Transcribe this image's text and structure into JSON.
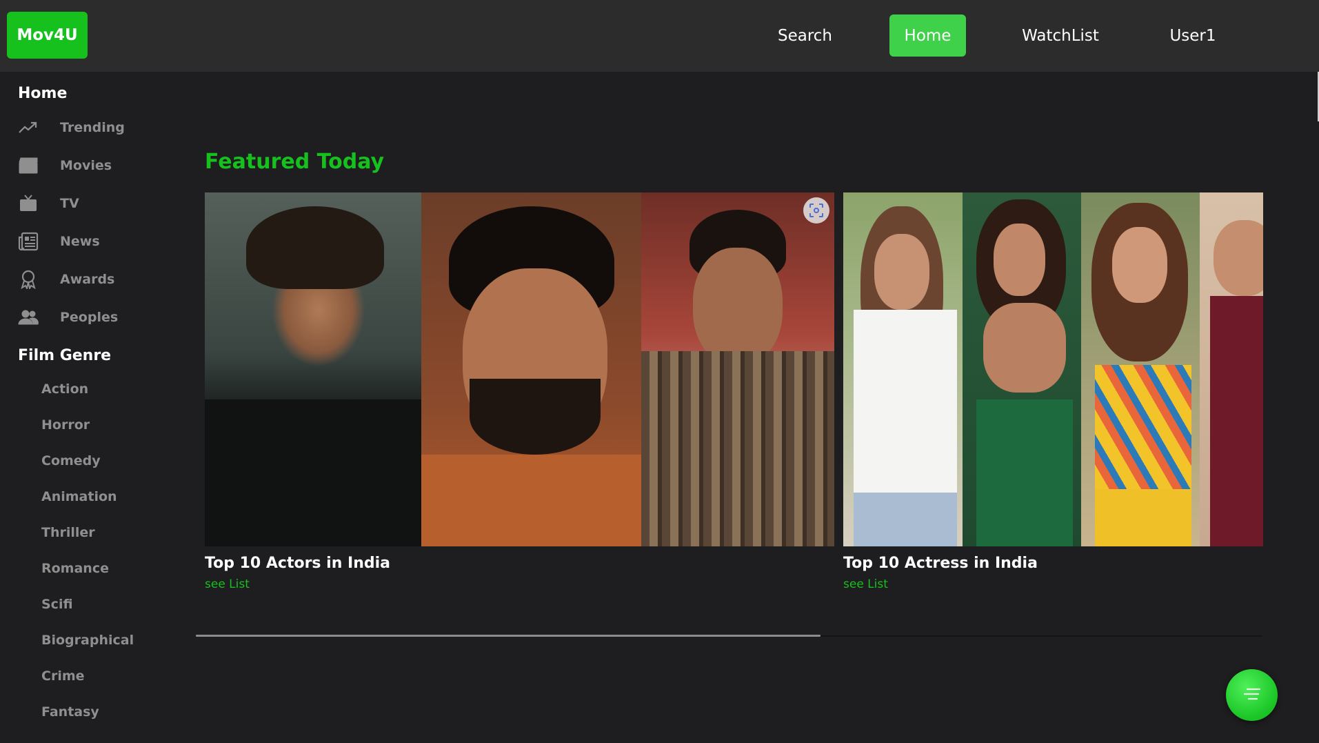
{
  "header": {
    "logo": "Mov4U",
    "nav": [
      "Search",
      "Home",
      "WatchList",
      "User1"
    ],
    "active_nav": "Home"
  },
  "sidebar": {
    "home_heading": "Home",
    "items": [
      {
        "label": "Trending",
        "icon": "trending-icon"
      },
      {
        "label": "Movies",
        "icon": "clapperboard-icon"
      },
      {
        "label": "TV",
        "icon": "tv-icon"
      },
      {
        "label": "News",
        "icon": "newspaper-icon"
      },
      {
        "label": "Awards",
        "icon": "award-icon"
      },
      {
        "label": "Peoples",
        "icon": "people-icon"
      }
    ],
    "genre_heading": "Film Genre",
    "genres": [
      "Action",
      "Horror",
      "Comedy",
      "Animation",
      "Thriller",
      "Romance",
      "Scifi",
      "Biographical",
      "Crime",
      "Fantasy"
    ]
  },
  "main": {
    "section_title": "Featured Today",
    "cards": [
      {
        "title": "Top 10 Actors in India",
        "link": "see List"
      },
      {
        "title": "Top 10 Actress in India",
        "link": "see List"
      }
    ]
  },
  "colors": {
    "accent": "#17c11d",
    "nav_active": "#3fd14a",
    "background": "#1e1d1f",
    "header": "#2c2c2d",
    "muted_text": "#8f8f8f"
  },
  "icons": {
    "image_action": "scan-icon",
    "fab": "menu-lines-icon"
  }
}
